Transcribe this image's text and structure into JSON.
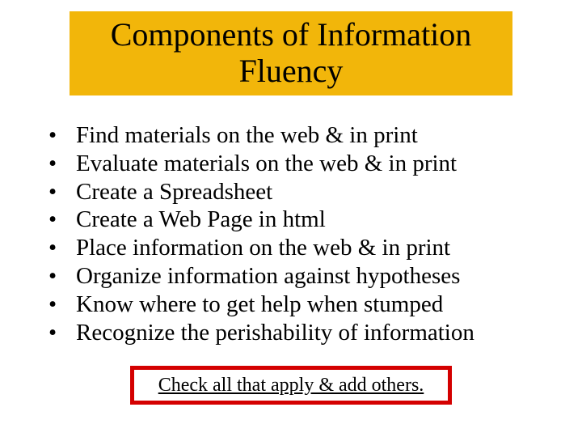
{
  "title": "Components of Information Fluency",
  "bullets": [
    "Find materials on the web & in print",
    "Evaluate materials on the web & in print",
    "Create a Spreadsheet",
    "Create a Web Page in html",
    "Place information on the web & in print",
    "Organize information against hypotheses",
    "Know where to get help when stumped",
    "Recognize the perishability of information"
  ],
  "footer": "Check all that apply & add others."
}
